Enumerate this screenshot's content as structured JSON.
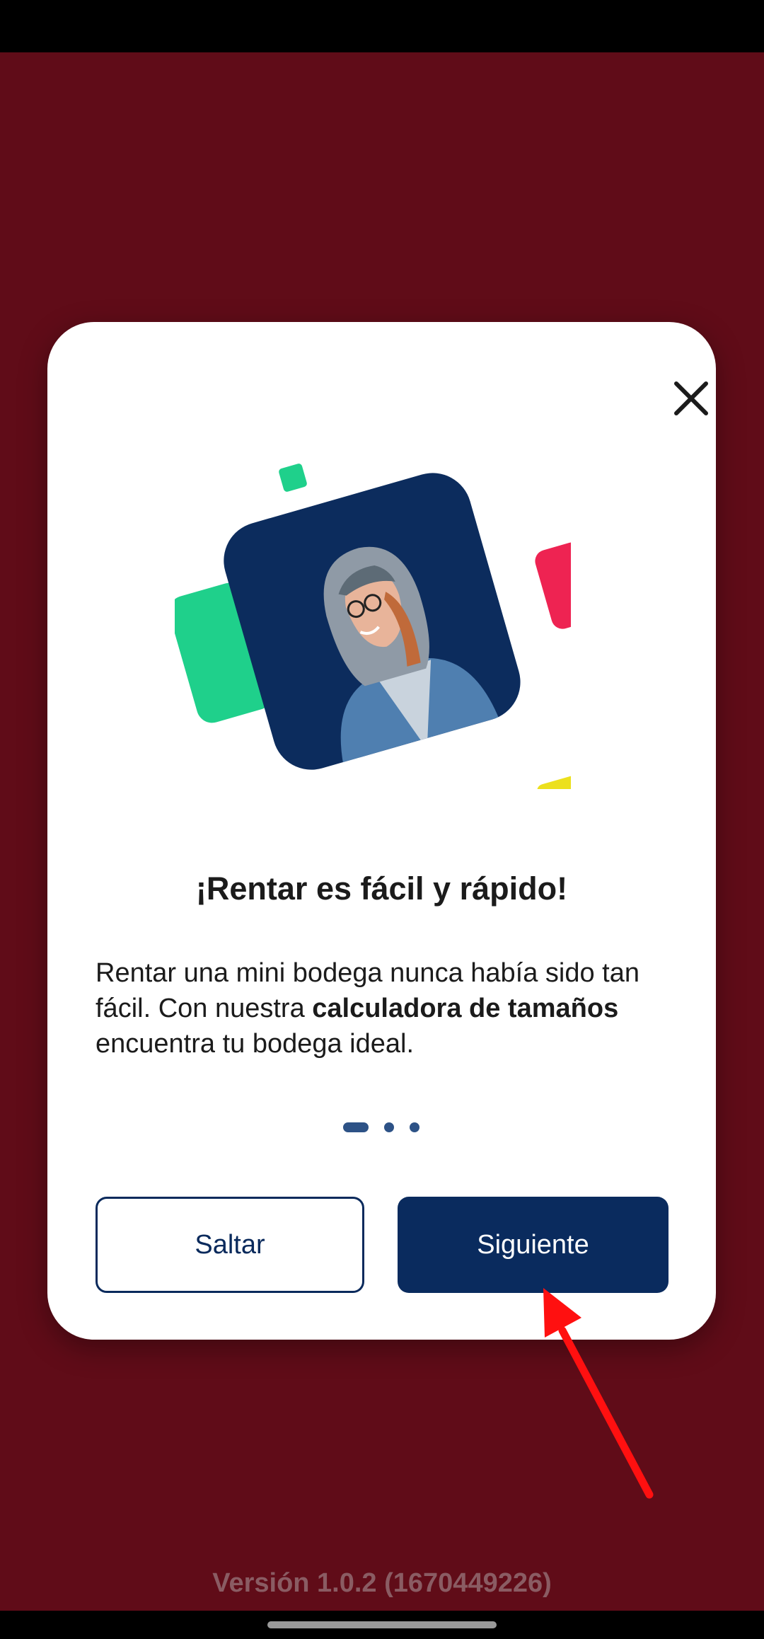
{
  "onboarding": {
    "title": "¡Rentar es fácil y rápido!",
    "body": {
      "part1": "Rentar una mini bodega nunca había sido tan fácil. Con nuestra ",
      "bold1": "calculadora de tamaños",
      "part2": " encuentra tu bodega ideal."
    },
    "page_indicator": {
      "current": 1,
      "total": 3
    },
    "skip_label": "Saltar",
    "next_label": "Siguiente",
    "close_icon": "close-icon"
  },
  "footer": {
    "version": "Versión 1.0.2 (1670449226)"
  },
  "colors": {
    "background": "#600c18",
    "primary": "#0a2b5e",
    "accent_green": "#1fd08b",
    "accent_red": "#ee2352",
    "accent_yellow": "#ece01d",
    "annotation_arrow": "#ff1010"
  }
}
